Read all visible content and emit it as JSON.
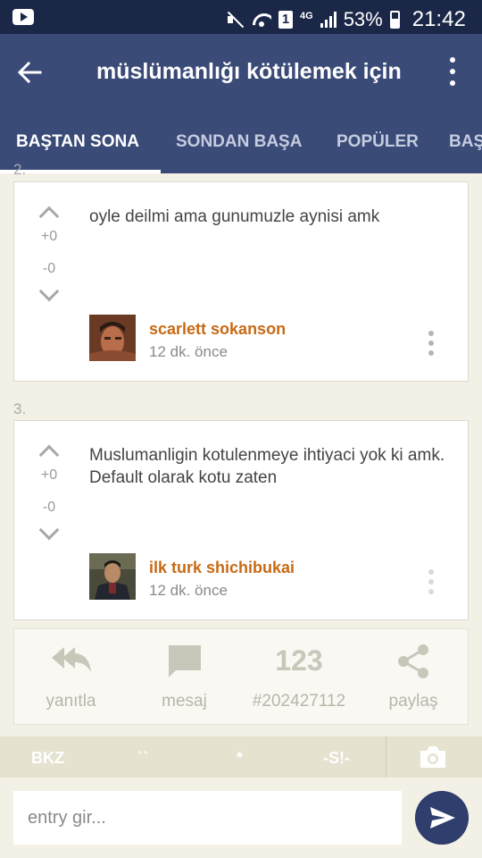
{
  "status_bar": {
    "battery": "53%",
    "time": "21:42",
    "network": "4G",
    "sim": "1"
  },
  "app_bar": {
    "title": "müslümanlığı kötülemek için"
  },
  "tabs": [
    {
      "label": "BAŞTAN SONA",
      "active": true
    },
    {
      "label": "SONDAN BAŞA"
    },
    {
      "label": "POPÜLER"
    },
    {
      "label": "BAŞ"
    }
  ],
  "entries": [
    {
      "number": "2.",
      "text": "oyle deilmi ama gunumuzle aynisi amk",
      "upvotes": "+0",
      "downvotes": "-0",
      "author": "scarlett sokanson",
      "date": "12 dk. önce"
    },
    {
      "number": "3.",
      "text": "Muslumanligin kotulenmeye ihtiyaci yok ki amk. Default olarak kotu zaten",
      "upvotes": "+0",
      "downvotes": "-0",
      "author": "ilk turk shichibukai",
      "date": "12 dk. önce"
    }
  ],
  "actions": {
    "reply": "yanıtla",
    "message": "mesaj",
    "entry_id": "#202427112",
    "share": "paylaş",
    "count_icon_text": "123"
  },
  "toolbar": {
    "bkz": "BKZ",
    "backticks": "``",
    "star": "*",
    "spoiler": "-S!-"
  },
  "input": {
    "placeholder": "entry gir..."
  },
  "colors": {
    "header": "#3b4b78",
    "status": "#1b2747",
    "author": "#c86a15",
    "background": "#f3f1e6"
  }
}
